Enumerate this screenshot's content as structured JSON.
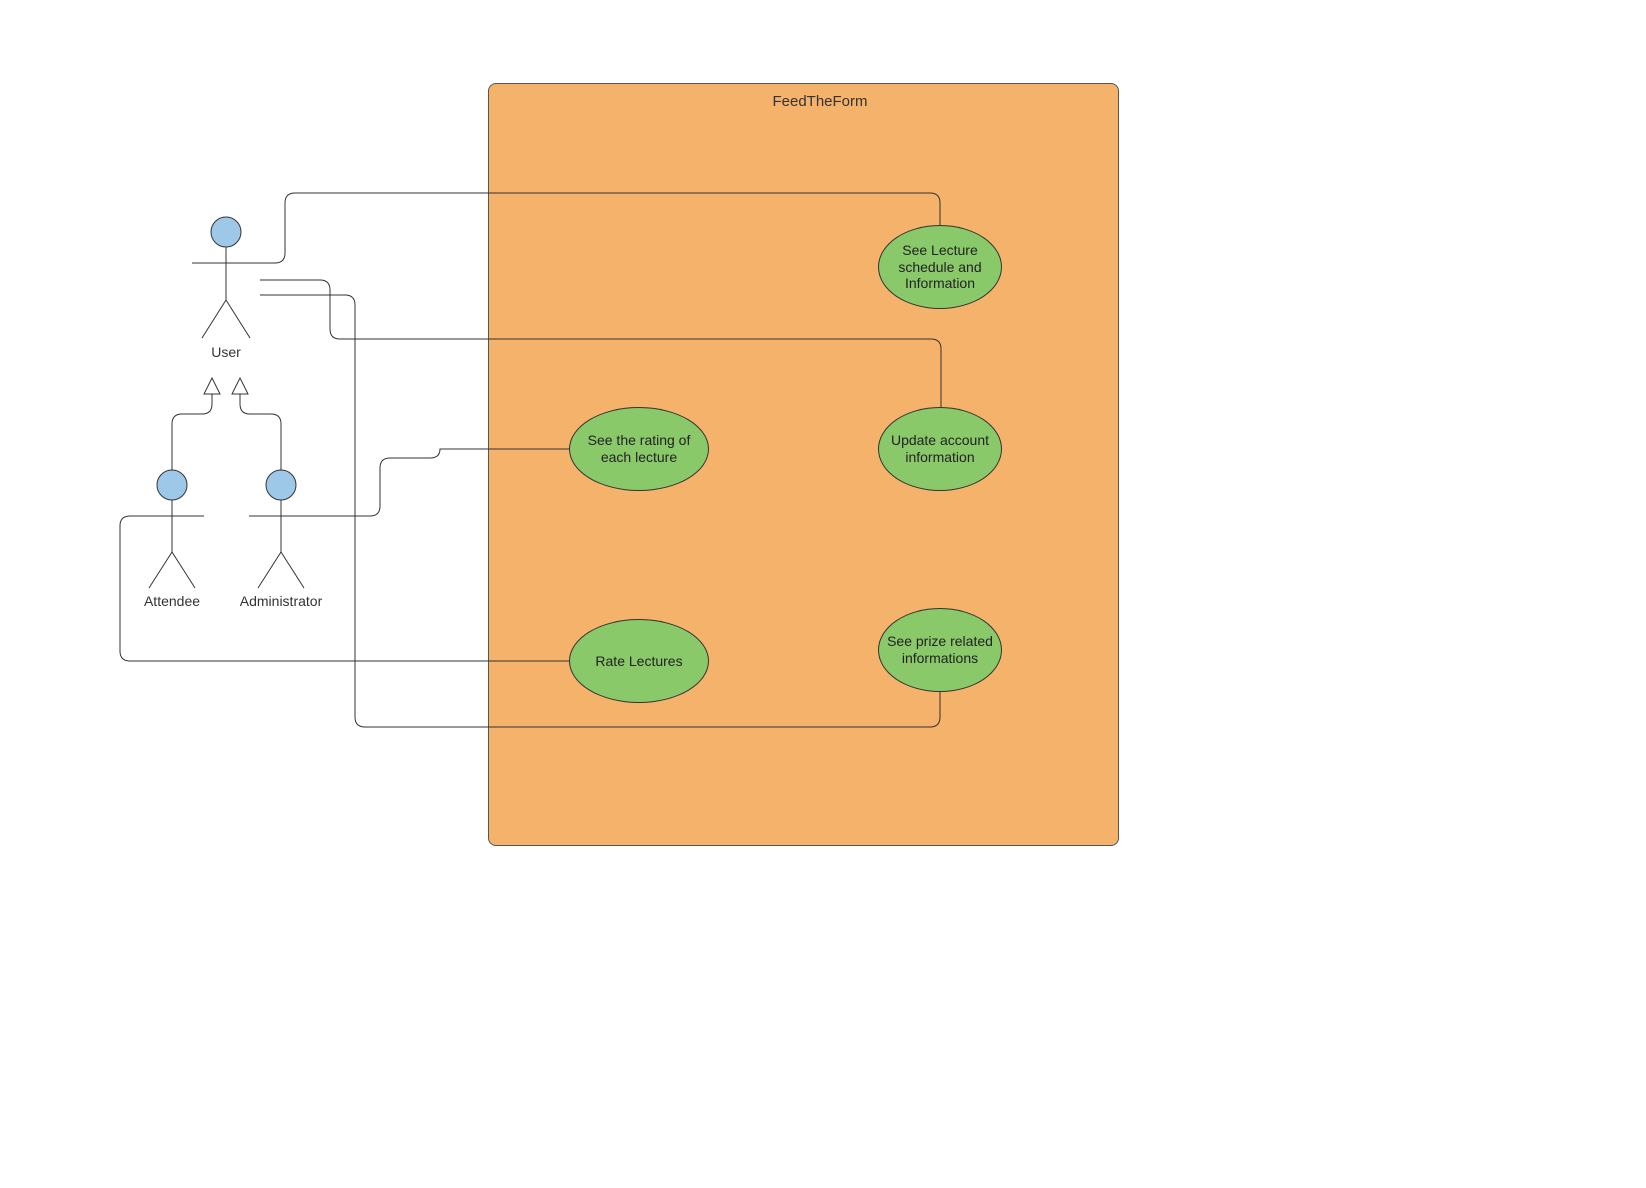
{
  "system": {
    "title": "FeedTheForm"
  },
  "actors": {
    "user": "User",
    "attendee": "Attendee",
    "administrator": "Administrator"
  },
  "usecases": {
    "seeLecture": "See Lecture schedule and Information",
    "seeRating": "See the rating of each lecture",
    "updateAccount": "Update account information",
    "rateLectures": "Rate Lectures",
    "seePrize": "See prize related informations"
  },
  "colors": {
    "systemFill": "#f4b26a",
    "usecaseFill": "#89c96a",
    "actorHead": "#9ec8e8"
  }
}
